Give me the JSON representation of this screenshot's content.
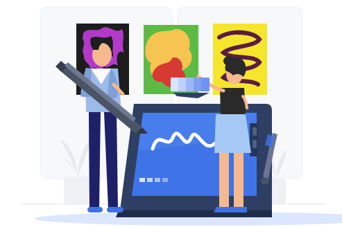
{
  "scene": {
    "description_type": "illustration",
    "colors": {
      "background": "#ffffff",
      "panel": "#f7f8fa",
      "panel_line": "#e8ebf0",
      "floor_shadow": "#dde6ff",
      "tablet_frame": "#2f3f63",
      "tablet_screen": "#3f73e8",
      "tablet_shadow": "#1e2c4a",
      "stylus": "#4b5466",
      "man_shirt": "#9dbbe9",
      "man_pants": "#1e2168",
      "man_skin": "#f6b88e",
      "woman_top": "#2a2a2a",
      "woman_skirt": "#a5c8f5",
      "woman_skin": "#f6b88e",
      "art_black": "#1d1d1d",
      "art_purple": "#b33ac9",
      "art_green": "#5dbb45",
      "art_orange": "#f6c451",
      "art_red": "#d63a33",
      "art_yellow": "#f6e52d",
      "art_maroon": "#5a1d44",
      "swatch_blue": "#6f93ef"
    },
    "icons": {
      "stylus": "pen-tablet-stylus",
      "plant_left": "leafy-plant-icon",
      "plant_right": "leafy-plant-icon"
    }
  }
}
